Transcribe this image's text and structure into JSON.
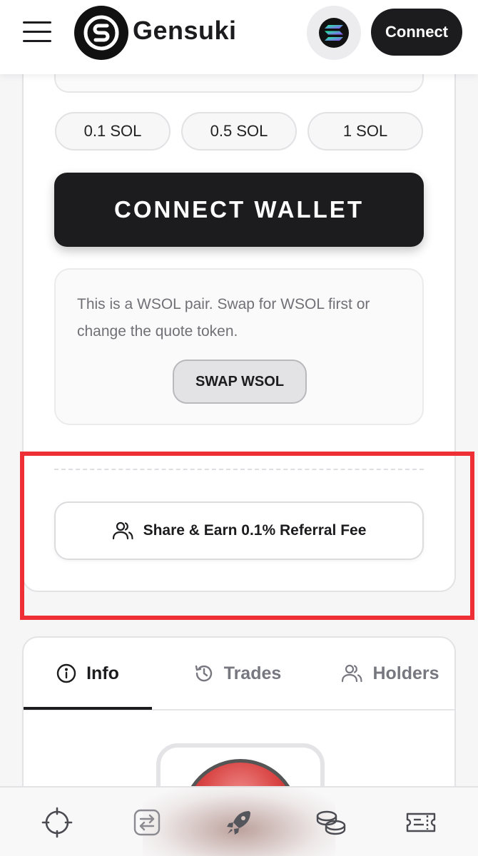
{
  "header": {
    "brand_name": "Gensuki",
    "connect_label": "Connect"
  },
  "trade": {
    "quick_amounts": [
      "0.1 SOL",
      "0.5 SOL",
      "1 SOL"
    ],
    "connect_wallet_label": "CONNECT WALLET",
    "wsol_notice": "This is a WSOL pair. Swap for WSOL first or change the quote token.",
    "swap_wsol_label": "SWAP WSOL",
    "referral_label": "Share & Earn 0.1% Referral Fee"
  },
  "tabs": [
    {
      "label": "Info",
      "icon": "info-icon",
      "active": true
    },
    {
      "label": "Trades",
      "icon": "history-icon",
      "active": false
    },
    {
      "label": "Holders",
      "icon": "users-icon",
      "active": false
    }
  ],
  "bottom_nav": [
    {
      "icon": "crosshair-icon"
    },
    {
      "icon": "swap-icon"
    },
    {
      "icon": "rocket-icon"
    },
    {
      "icon": "coins-icon"
    },
    {
      "icon": "ticket-icon"
    }
  ],
  "colors": {
    "primary_dark": "#1c1c1e",
    "highlight_red": "#ee2f35",
    "muted_text": "#707076"
  }
}
